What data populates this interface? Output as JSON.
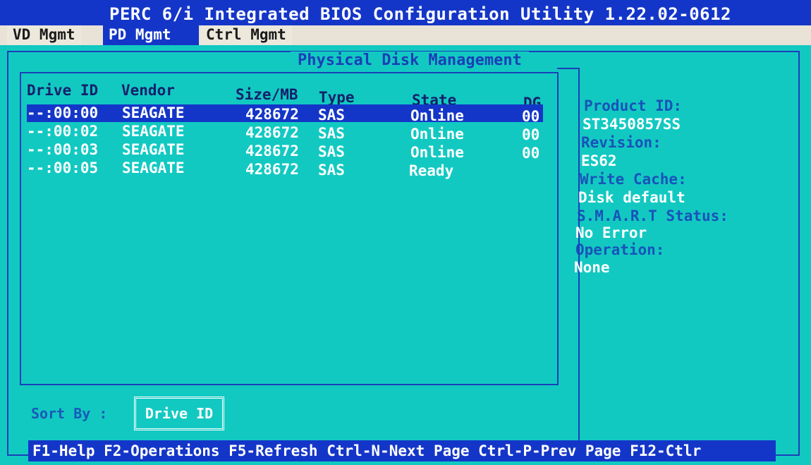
{
  "window": {
    "title": "PERC 6/i Integrated BIOS Configuration Utility 1.22.02-0612"
  },
  "tabs": [
    {
      "label": "VD Mgmt"
    },
    {
      "label": "PD Mgmt"
    },
    {
      "label": "Ctrl Mgmt"
    }
  ],
  "active_tab": "PD Mgmt",
  "panel": {
    "title": "Physical Disk Management"
  },
  "table": {
    "columns": [
      "Drive ID",
      "Vendor",
      "Size/MB",
      "Type",
      "State",
      "DG"
    ],
    "rows": [
      {
        "drive_id": "--:00:00",
        "vendor": "SEAGATE",
        "size_mb": "428672",
        "type": "SAS",
        "state": "Online",
        "dg": "00"
      },
      {
        "drive_id": "--:00:02",
        "vendor": "SEAGATE",
        "size_mb": "428672",
        "type": "SAS",
        "state": "Online",
        "dg": "00"
      },
      {
        "drive_id": "--:00:03",
        "vendor": "SEAGATE",
        "size_mb": "428672",
        "type": "SAS",
        "state": "Online",
        "dg": "00"
      },
      {
        "drive_id": "--:00:05",
        "vendor": "SEAGATE",
        "size_mb": "428672",
        "type": "SAS",
        "state": "Ready",
        "dg": ""
      }
    ]
  },
  "details": {
    "product_id_label": "Product ID:",
    "product_id_value": "ST3450857SS",
    "revision_label": "Revision:",
    "revision_value": "ES62",
    "write_cache_label": "Write Cache:",
    "write_cache_value": "Disk default",
    "smart_label": "S.M.A.R.T Status:",
    "smart_value": "No Error",
    "operation_label": "Operation:",
    "operation_value": "None"
  },
  "sort": {
    "label": "Sort By :",
    "value": "Drive ID"
  },
  "help_bar": {
    "text": "F1-Help F2-Operations F5-Refresh Ctrl-N-Next Page Ctrl-P-Prev Page F12-Ctlr"
  },
  "colors": {
    "background": "#12c9c2",
    "highlight": "#1436c8",
    "frame": "#1a3fb8",
    "text": "#ffffff"
  }
}
